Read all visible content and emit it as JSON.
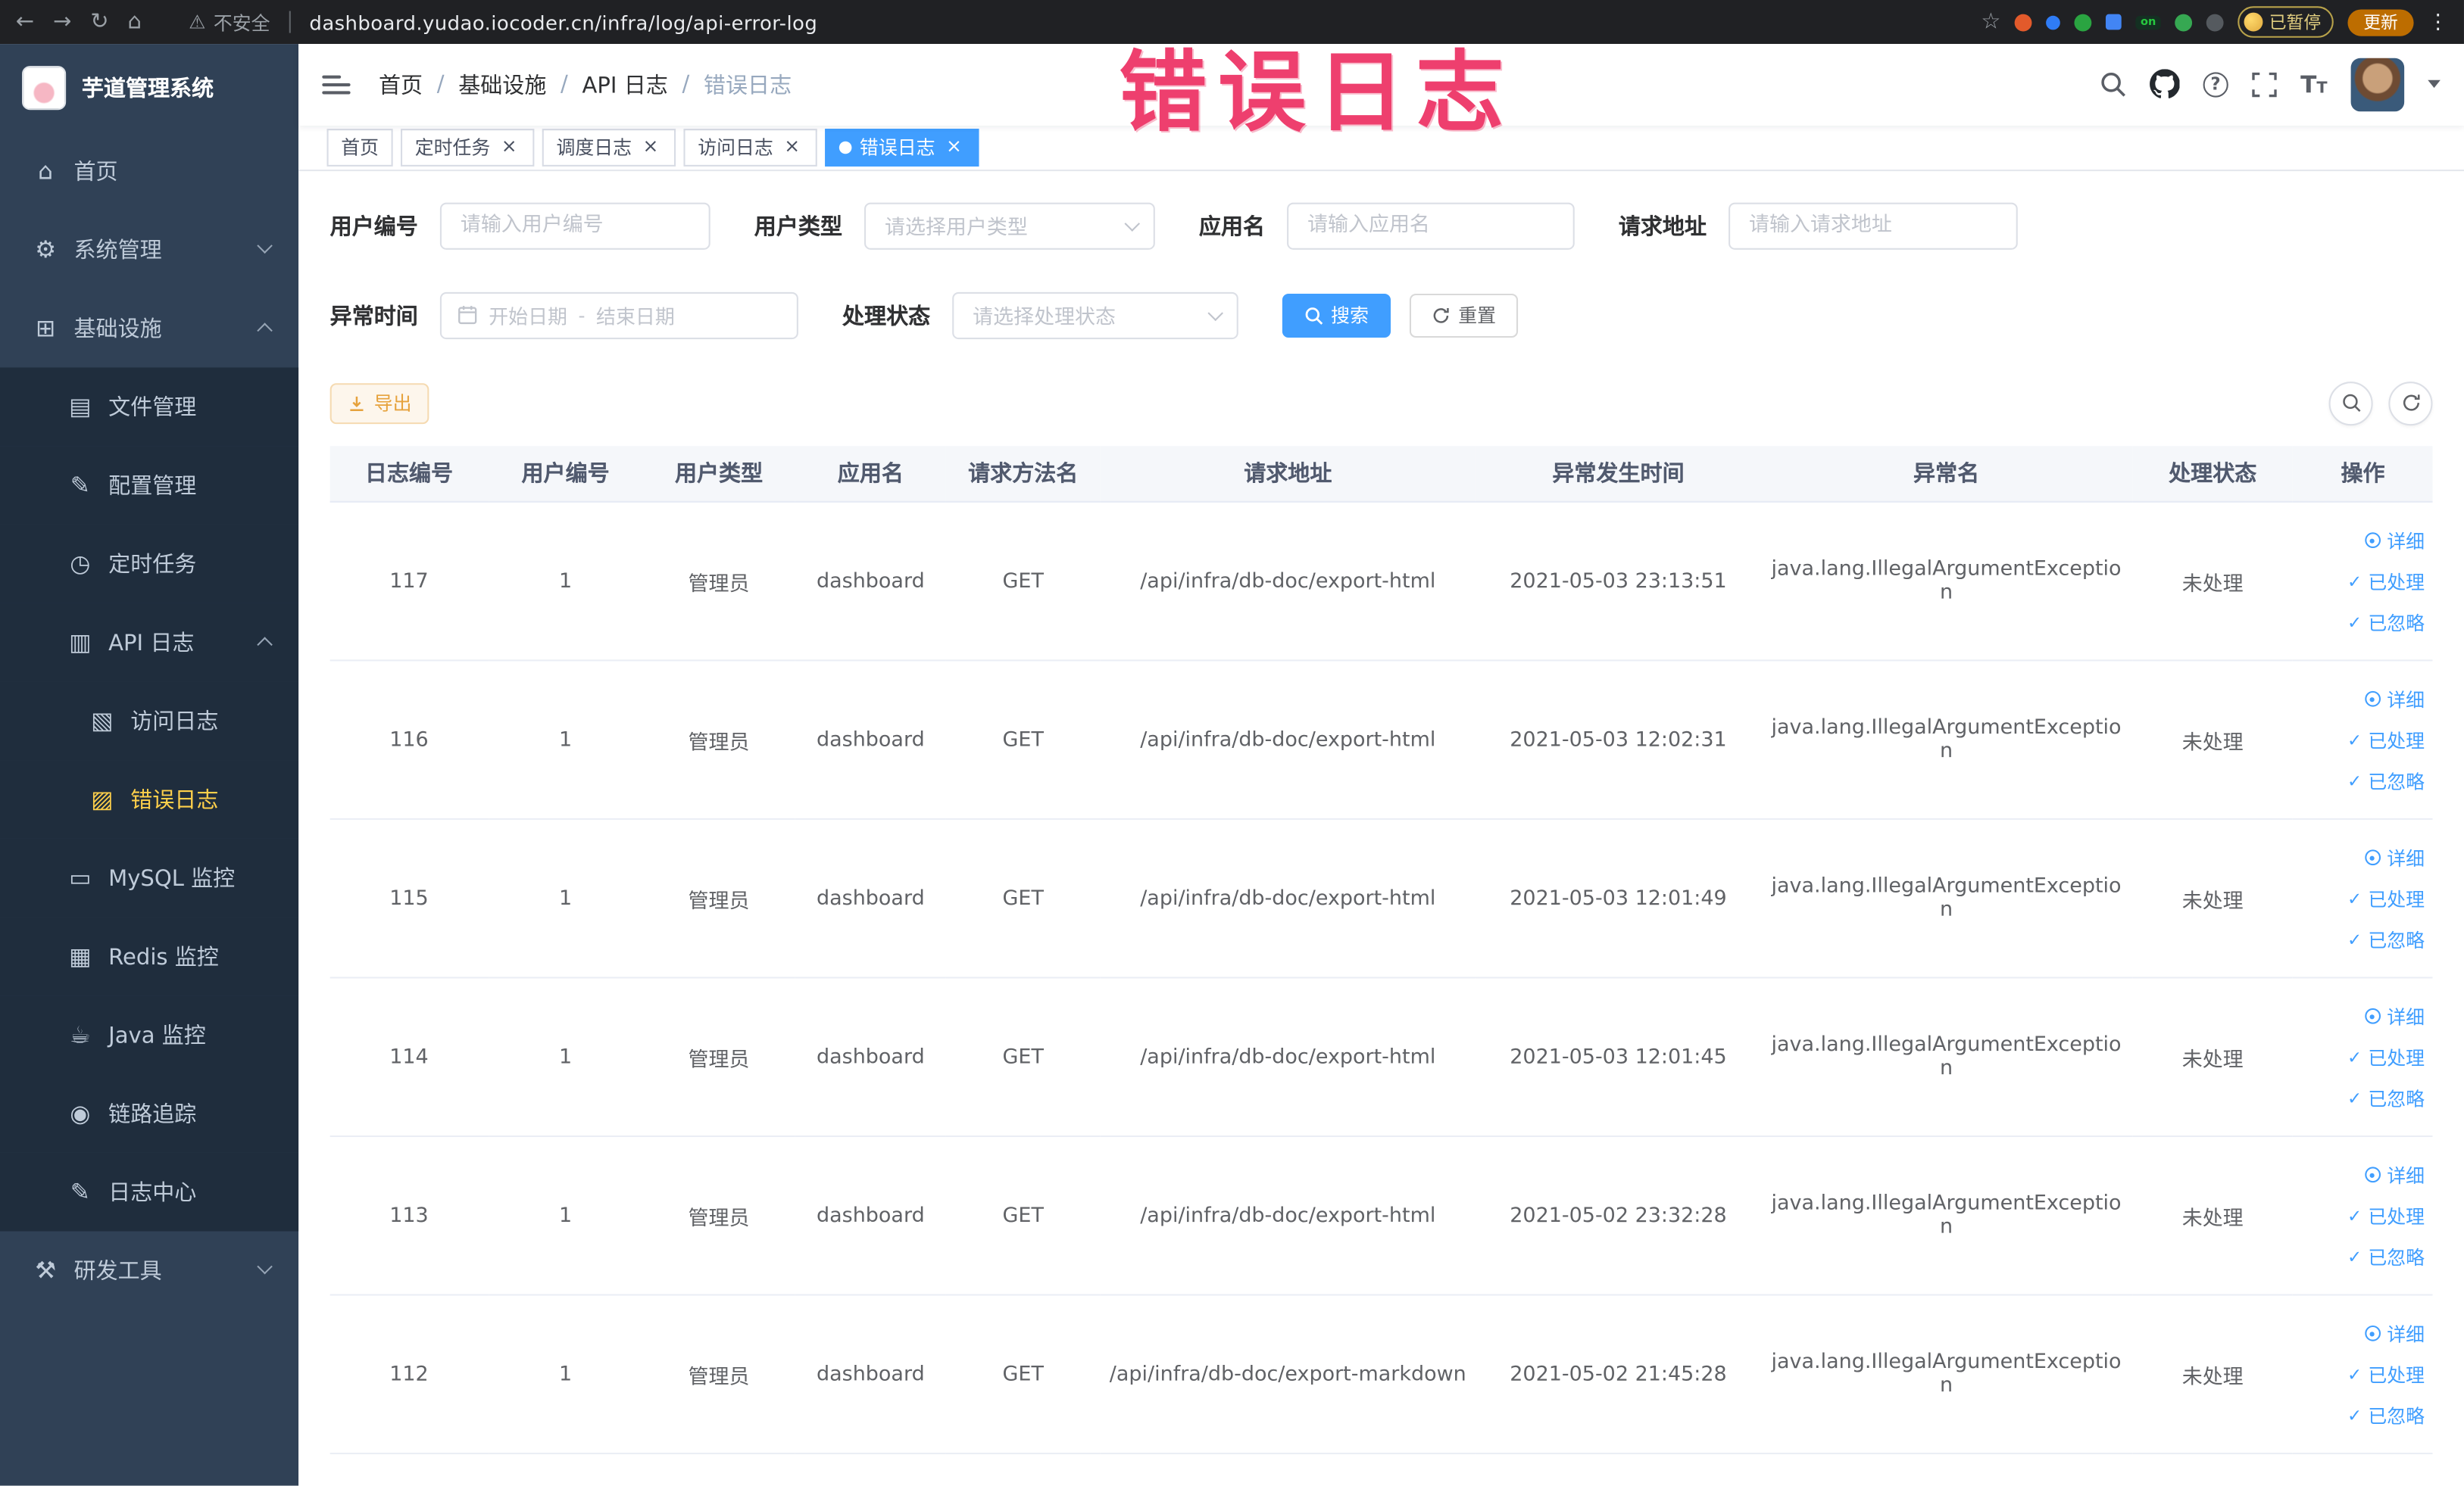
{
  "theme": {
    "primary": "#409eff",
    "warning": "#e6a23c",
    "sidebar_bg": "#304156",
    "submenu_bg": "#1f2d3d",
    "active_menu_text": "#ffd04b",
    "annotation_color": "#ee3f6e",
    "chrome_bg": "#202124"
  },
  "browser": {
    "security_label": "不安全",
    "url": "dashboard.yudao.iocoder.cn/infra/log/api-error-log",
    "extension_on_label": "on",
    "paused_badge": "已暂停",
    "update_button": "更新"
  },
  "annotation": {
    "text": "错误日志"
  },
  "sidebar": {
    "logo_title": "芋道管理系统",
    "items": [
      {
        "name": "home",
        "label": "首页",
        "icon": "⌂",
        "level": 0
      },
      {
        "name": "system-management",
        "label": "系统管理",
        "icon": "⚙",
        "level": 0,
        "arrow": "down"
      },
      {
        "name": "infrastructure",
        "label": "基础设施",
        "icon": "⊞",
        "level": 0,
        "arrow": "up"
      },
      {
        "name": "file-management",
        "label": "文件管理",
        "icon": "▤",
        "level": 1,
        "sub": true
      },
      {
        "name": "config-management",
        "label": "配置管理",
        "icon": "✎",
        "level": 1,
        "sub": true
      },
      {
        "name": "scheduled-tasks",
        "label": "定时任务",
        "icon": "◷",
        "level": 1,
        "sub": true
      },
      {
        "name": "api-logs",
        "label": "API 日志",
        "icon": "▥",
        "level": 1,
        "sub": true,
        "arrow": "up"
      },
      {
        "name": "access-logs",
        "label": "访问日志",
        "icon": "▧",
        "level": 2,
        "sub": true
      },
      {
        "name": "error-logs",
        "label": "错误日志",
        "icon": "▨",
        "level": 2,
        "sub": true,
        "active": true
      },
      {
        "name": "mysql-monitor",
        "label": "MySQL 监控",
        "icon": "▭",
        "level": 1,
        "sub": true
      },
      {
        "name": "redis-monitor",
        "label": "Redis 监控",
        "icon": "▦",
        "level": 1,
        "sub": true
      },
      {
        "name": "java-monitor",
        "label": "Java 监控",
        "icon": "☕",
        "level": 1,
        "sub": true
      },
      {
        "name": "trace",
        "label": "链路追踪",
        "icon": "◉",
        "level": 1,
        "sub": true
      },
      {
        "name": "log-center",
        "label": "日志中心",
        "icon": "✎",
        "level": 1,
        "sub": true
      },
      {
        "name": "dev-tools",
        "label": "研发工具",
        "icon": "⚒",
        "level": 0,
        "arrow": "down"
      }
    ]
  },
  "breadcrumb": {
    "items": [
      "首页",
      "基础设施",
      "API 日志",
      "错误日志"
    ]
  },
  "tabs": [
    {
      "label": "首页",
      "closable": false,
      "active": false
    },
    {
      "label": "定时任务",
      "closable": true,
      "active": false
    },
    {
      "label": "调度日志",
      "closable": true,
      "active": false
    },
    {
      "label": "访问日志",
      "closable": true,
      "active": false
    },
    {
      "label": "错误日志",
      "closable": true,
      "active": true
    }
  ],
  "filters": {
    "user_id": {
      "label": "用户编号",
      "placeholder": "请输入用户编号"
    },
    "user_type": {
      "label": "用户类型",
      "placeholder": "请选择用户类型"
    },
    "app_name": {
      "label": "应用名",
      "placeholder": "请输入应用名"
    },
    "request_url": {
      "label": "请求地址",
      "placeholder": "请输入请求地址"
    },
    "exception_time": {
      "label": "异常时间",
      "start_placeholder": "开始日期",
      "separator": "-",
      "end_placeholder": "结束日期"
    },
    "process_status": {
      "label": "处理状态",
      "placeholder": "请选择处理状态"
    },
    "search_button": "搜索",
    "reset_button": "重置"
  },
  "toolbar": {
    "export_button": "导出"
  },
  "table": {
    "columns": [
      "日志编号",
      "用户编号",
      "用户类型",
      "应用名",
      "请求方法名",
      "请求地址",
      "异常发生时间",
      "异常名",
      "处理状态",
      "操作"
    ],
    "row_keys": [
      "log_id",
      "user_id",
      "user_type",
      "app_name",
      "method",
      "url",
      "time",
      "exception",
      "status"
    ],
    "rows": [
      {
        "log_id": "117",
        "user_id": "1",
        "user_type": "管理员",
        "app_name": "dashboard",
        "method": "GET",
        "url": "/api/infra/db-doc/export-html",
        "time": "2021-05-03 23:13:51",
        "exception": "java.lang.IllegalArgumentException",
        "status": "未处理"
      },
      {
        "log_id": "116",
        "user_id": "1",
        "user_type": "管理员",
        "app_name": "dashboard",
        "method": "GET",
        "url": "/api/infra/db-doc/export-html",
        "time": "2021-05-03 12:02:31",
        "exception": "java.lang.IllegalArgumentException",
        "status": "未处理"
      },
      {
        "log_id": "115",
        "user_id": "1",
        "user_type": "管理员",
        "app_name": "dashboard",
        "method": "GET",
        "url": "/api/infra/db-doc/export-html",
        "time": "2021-05-03 12:01:49",
        "exception": "java.lang.IllegalArgumentException",
        "status": "未处理"
      },
      {
        "log_id": "114",
        "user_id": "1",
        "user_type": "管理员",
        "app_name": "dashboard",
        "method": "GET",
        "url": "/api/infra/db-doc/export-html",
        "time": "2021-05-03 12:01:45",
        "exception": "java.lang.IllegalArgumentException",
        "status": "未处理"
      },
      {
        "log_id": "113",
        "user_id": "1",
        "user_type": "管理员",
        "app_name": "dashboard",
        "method": "GET",
        "url": "/api/infra/db-doc/export-html",
        "time": "2021-05-02 23:32:28",
        "exception": "java.lang.IllegalArgumentException",
        "status": "未处理"
      },
      {
        "log_id": "112",
        "user_id": "1",
        "user_type": "管理员",
        "app_name": "dashboard",
        "method": "GET",
        "url": "/api/infra/db-doc/export-markdown",
        "time": "2021-05-02 21:45:28",
        "exception": "java.lang.IllegalArgumentException",
        "status": "未处理"
      }
    ],
    "actions": {
      "detail": "详细",
      "processed": "已处理",
      "ignored": "已忽略"
    }
  }
}
